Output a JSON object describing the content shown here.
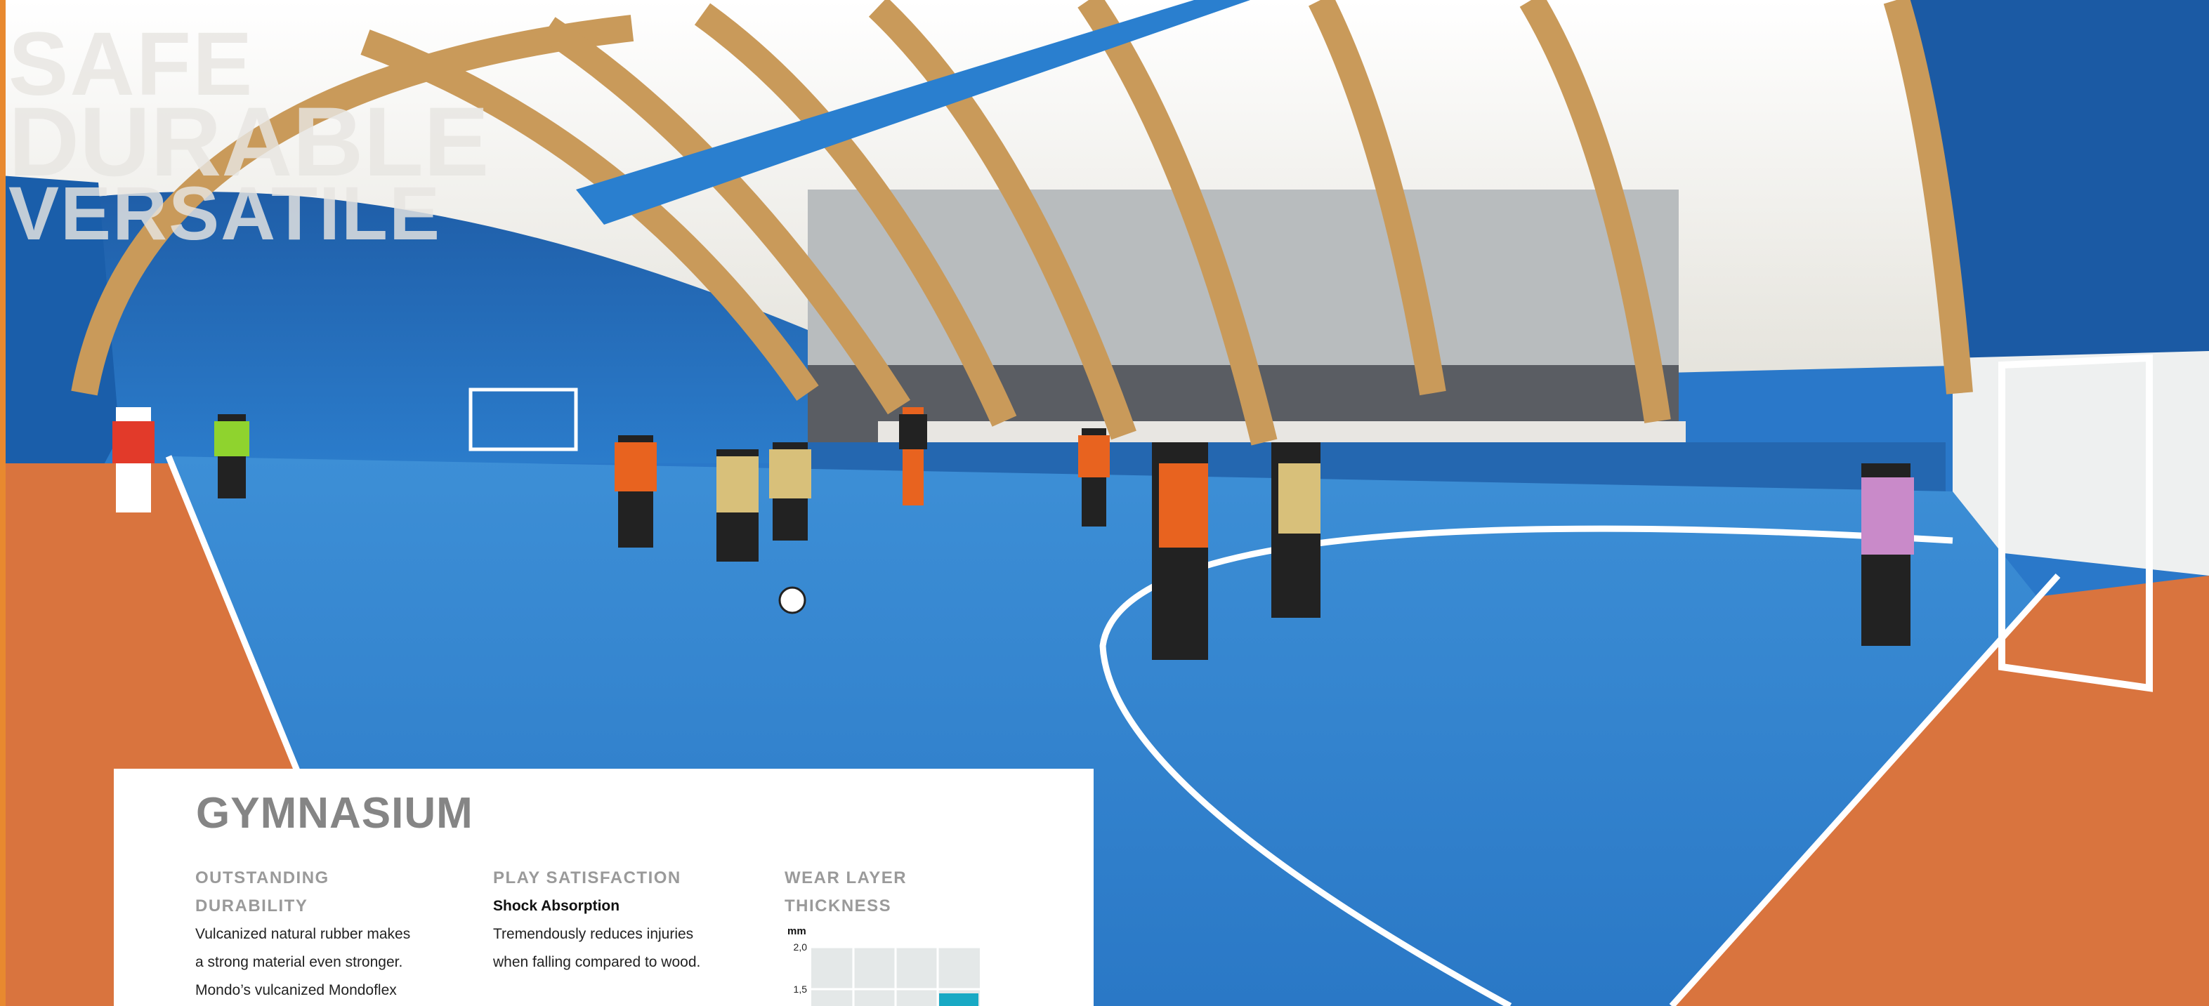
{
  "headline": {
    "lines": [
      "SAFE",
      "DURABLE",
      "VERSATILE"
    ]
  },
  "panel": {
    "title": "GYMNASIUM",
    "columns": [
      {
        "heading_lines": [
          "OUTSTANDING",
          "DURABILITY"
        ],
        "body_lines": [
          "Vulcanized natural rubber makes",
          "a strong material even stronger.",
          "Mondo’s vulcanized Mondoflex"
        ]
      },
      {
        "heading_lines": [
          "PLAY SATISFACTION"
        ],
        "subheading": "Shock Absorption",
        "body_lines": [
          "Tremendously reduces injuries",
          "when falling compared to wood."
        ]
      },
      {
        "heading_lines": [
          "WEAR LAYER",
          "THICKNESS"
        ]
      }
    ]
  },
  "chart_data": {
    "type": "bar",
    "ylabel": "mm",
    "yticks": [
      "2,0",
      "1,5"
    ],
    "ylim": [
      1.5,
      2.0
    ],
    "categories": [
      "",
      "",
      "",
      ""
    ],
    "values": [
      null,
      null,
      null,
      1.45
    ],
    "colors": {
      "bar": "#18a9c4",
      "grid": "#e4e8e8"
    }
  },
  "colors": {
    "floor": "#2f82cf",
    "apron": "#d9743e",
    "wall": "#1f66b4",
    "roof": "#f1f0ea",
    "arch": "#c99a5a"
  }
}
